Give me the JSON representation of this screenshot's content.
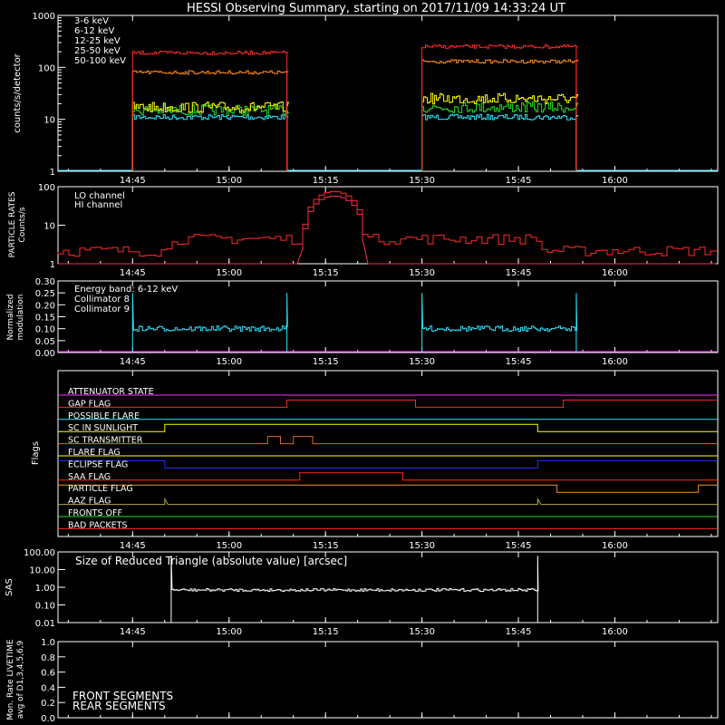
{
  "title": "HESSI Observing Summary, starting on 2017/11/09 14:33:24 UT",
  "time_ticks": [
    "14:45",
    "15:00",
    "15:15",
    "15:30",
    "15:45",
    "16:00"
  ],
  "colors": {
    "red": "#ff2a2a",
    "orange": "#ff8a1c",
    "yellow": "#ffff00",
    "green": "#22e022",
    "cyan": "#29e6ff",
    "magenta": "#ff2dff",
    "blue": "#2630ff",
    "olive": "#b0a64a",
    "brown": "#d86a28",
    "crimson": "#ff2a55"
  },
  "chart_data": [
    {
      "type": "line",
      "panel": "count_rates",
      "ylabel": "counts/s/detector",
      "ylim": [
        1,
        1000
      ],
      "log_y": true,
      "y_ticks": [
        "1",
        "10",
        "100",
        "1000"
      ],
      "legend": [
        "3-6 keV",
        "6-12 keV",
        "12-25 keV",
        "25-50 keV",
        "50-100 keV"
      ],
      "intervals": [
        [
          "14:45",
          "15:09"
        ],
        [
          "15:30",
          "15:54"
        ]
      ],
      "series": [
        {
          "name": "3-6 keV",
          "color_key": "red",
          "levels": [
            190,
            250
          ]
        },
        {
          "name": "6-12 keV",
          "color_key": "orange",
          "levels": [
            80,
            130
          ]
        },
        {
          "name": "12-25 keV",
          "color_key": "yellow",
          "levels": [
            17,
            25
          ]
        },
        {
          "name": "25-50 keV",
          "color_key": "green",
          "levels": [
            15,
            17
          ]
        },
        {
          "name": "50-100 keV",
          "color_key": "cyan",
          "levels": [
            11,
            11
          ]
        }
      ]
    },
    {
      "type": "line",
      "panel": "particle_rates",
      "ylabel_lines": [
        "PARTICLE RATES",
        "Counts/s"
      ],
      "ylim": [
        1,
        100
      ],
      "log_y": true,
      "y_ticks": [
        "1",
        "10",
        "100"
      ],
      "legend": [
        "LO channel",
        "HI channel"
      ],
      "baseline": 3,
      "saa_peak": 75,
      "saa_interval": [
        "15:11",
        "15:21"
      ]
    },
    {
      "type": "line",
      "panel": "modulation",
      "ylabel_lines": [
        "Normalized",
        "modulation"
      ],
      "ylim": [
        0,
        0.3
      ],
      "y_ticks": [
        "0.00",
        "0.05",
        "0.10",
        "0.15",
        "0.20",
        "0.25",
        "0.30"
      ],
      "legend": [
        "Energy band: 6-12 keV",
        "Collimator 8",
        "Collimator 9"
      ],
      "level": 0.1,
      "spike_level": 0.25
    },
    {
      "type": "line",
      "panel": "flags",
      "ylabel": "Flags",
      "flags": [
        {
          "name": "ATTENUATOR STATE",
          "color_key": "magenta"
        },
        {
          "name": "GAP FLAG",
          "color_key": "red"
        },
        {
          "name": "POSSIBLE FLARE",
          "color_key": "cyan"
        },
        {
          "name": "SC IN SUNLIGHT",
          "color_key": "yellow"
        },
        {
          "name": "SC TRANSMITTER",
          "color_key": "brown"
        },
        {
          "name": "FLARE FLAG",
          "color_key": "yellow"
        },
        {
          "name": "ECLIPSE FLAG",
          "color_key": "blue"
        },
        {
          "name": "SAA FLAG",
          "color_key": "red"
        },
        {
          "name": "PARTICLE FLAG",
          "color_key": "orange"
        },
        {
          "name": "AAZ FLAG",
          "color_key": "olive"
        },
        {
          "name": "FRONTS OFF",
          "color_key": "green"
        },
        {
          "name": "BAD PACKETS",
          "color_key": "red"
        }
      ]
    },
    {
      "type": "line",
      "panel": "sas",
      "ylabel": "SAS",
      "ylim": [
        0.01,
        100
      ],
      "log_y": true,
      "y_ticks": [
        "0.01",
        "0.10",
        "1.00",
        "10.00",
        "100.00"
      ],
      "label": "Size of Reduced Triangle (absolute value) [arcsec]",
      "level": 0.7,
      "interval": [
        "14:51",
        "15:48"
      ]
    },
    {
      "type": "line",
      "panel": "livetime",
      "ylabel_lines": [
        "Mon. Rate LIVETIME",
        "avg of D1,3,4,5,6,9"
      ],
      "ylim": [
        0,
        1
      ],
      "y_ticks": [
        "0.0",
        "0.2",
        "0.4",
        "0.6",
        "0.8",
        "1.0"
      ],
      "legend": [
        "FRONT SEGMENTS",
        "REAR SEGMENTS"
      ]
    }
  ]
}
